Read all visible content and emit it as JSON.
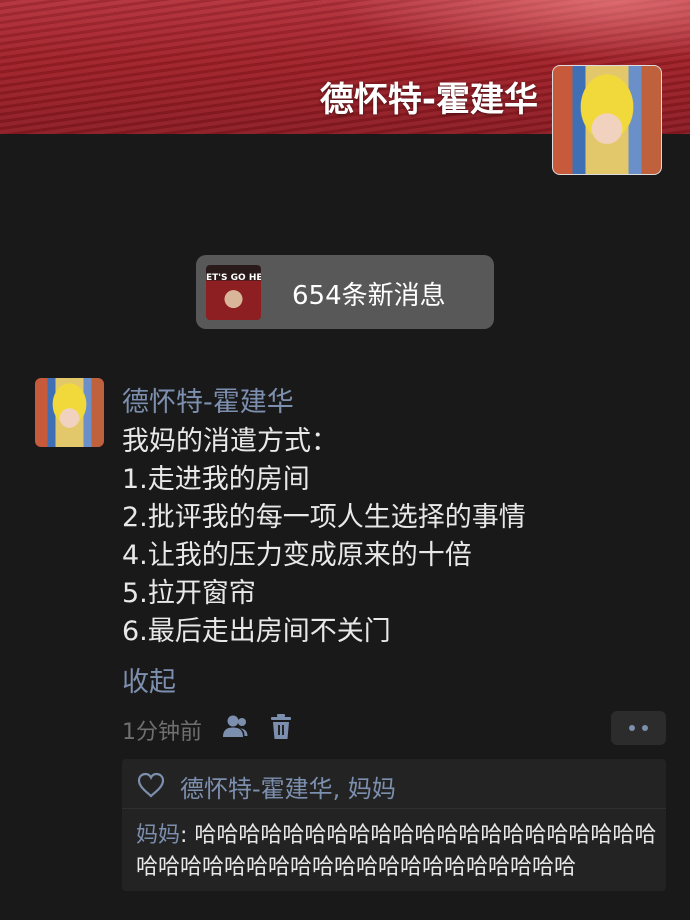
{
  "profile": {
    "name": "德怀特-霍建华"
  },
  "new_messages": {
    "label": "654条新消息",
    "thumb_text": "ET'S GO HEA"
  },
  "post": {
    "author": "德怀特-霍建华",
    "lines": [
      "我妈的消遣方式：",
      "1.走进我的房间",
      "2.批评我的每一项人生选择的事情",
      "4.让我的压力变成原来的十倍",
      "5.拉开窗帘",
      "6.最后走出房间不关门"
    ],
    "collapse_label": "收起",
    "time": "1分钟前",
    "icons": {
      "visibility": "friends-icon",
      "delete": "trash-icon",
      "more": "more-dots-icon",
      "like": "heart-icon"
    }
  },
  "likes": {
    "names": "德怀特-霍建华, 妈妈"
  },
  "comment": {
    "author": "妈妈",
    "separator": ": ",
    "text": "哈哈哈哈哈哈哈哈哈哈哈哈哈哈哈哈哈哈哈哈哈哈哈哈哈哈哈哈哈哈哈哈哈哈哈哈哈哈哈哈哈"
  },
  "colors": {
    "background": "#191919",
    "link": "#7d8fae",
    "text": "#e8e8e8",
    "pill": "#585858"
  }
}
